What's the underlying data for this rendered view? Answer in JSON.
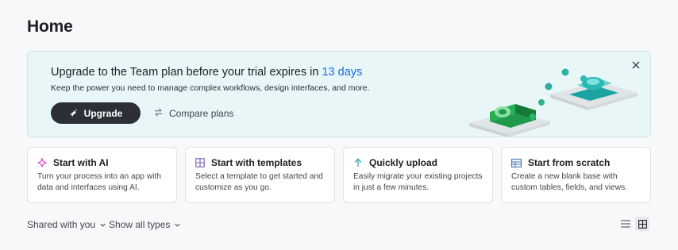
{
  "page": {
    "title": "Home"
  },
  "banner": {
    "title_prefix": "Upgrade to the Team plan before your trial expires in ",
    "title_days": "13 days",
    "subtitle": "Keep the power you need to manage complex workflows, design interfaces, and more.",
    "upgrade_label": "Upgrade",
    "compare_label": "Compare plans",
    "close_icon": "close-icon"
  },
  "cards": [
    {
      "title": "Start with AI",
      "icon": "sparkle-icon",
      "desc": "Turn your process into an app with data and interfaces using AI."
    },
    {
      "title": "Start with templates",
      "icon": "grid-icon",
      "desc": "Select a template to get started and customize as you go."
    },
    {
      "title": "Quickly upload",
      "icon": "arrow-up-icon",
      "desc": "Easily migrate your existing projects in just a few minutes."
    },
    {
      "title": "Start from scratch",
      "icon": "table-icon",
      "desc": "Create a new blank base with custom tables, fields, and views."
    }
  ],
  "filters": {
    "shared_label": "Shared with you",
    "types_label": "Show all types"
  },
  "view": {
    "list_icon": "list-icon",
    "grid_icon": "grid-view-icon",
    "active": "grid"
  },
  "colors": {
    "accent": "#166ee1",
    "banner_bg": "#e8f6f7",
    "button_dark": "#2c2f36",
    "ai_pink": "#d63ec7",
    "teal": "#1aa3a0"
  }
}
